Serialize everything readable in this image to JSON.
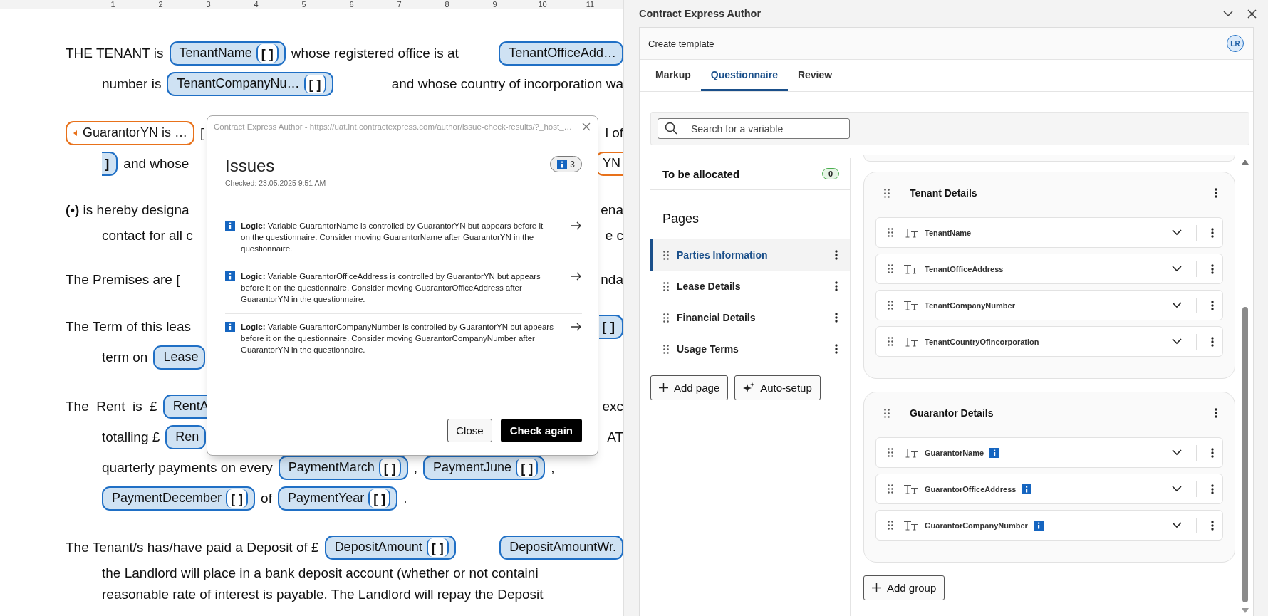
{
  "document": {
    "ruler": [
      "1",
      "2",
      "3",
      "4",
      "5",
      "6",
      "7",
      "8",
      "9",
      "10",
      "11"
    ],
    "paragraphs": [
      {
        "lines": [
          {
            "left": [
              {
                "kind": "text",
                "text": "THE TENANT is"
              },
              {
                "kind": "field",
                "name": "TenantName",
                "placeholder": "[ ]"
              },
              {
                "kind": "text",
                "text": "whose registered office is at"
              }
            ],
            "right": [
              {
                "kind": "field",
                "name": "TenantOfficeAdd…"
              }
            ]
          },
          {
            "left": [
              {
                "kind": "text",
                "text": "number is"
              },
              {
                "kind": "field",
                "name": "TenantCompanyNu…",
                "placeholder": "[ ]"
              }
            ],
            "right": [
              {
                "kind": "text",
                "text": "and whose country of incorporation wa"
              }
            ]
          }
        ]
      },
      {
        "lines": [
          {
            "left": [
              {
                "kind": "condition",
                "name": "GuarantorYN is …"
              },
              {
                "kind": "text",
                "text": "["
              }
            ],
            "right": [
              {
                "kind": "text",
                "text": "l of"
              }
            ]
          },
          {
            "left": [
              {
                "kind": "tail",
                "text": "]"
              },
              {
                "kind": "text",
                "text": "and whose"
              }
            ],
            "right": [
              {
                "kind": "condition_tail",
                "text": "YN"
              }
            ]
          }
        ]
      },
      {
        "lines": [
          {
            "left": [
              {
                "kind": "text",
                "text": "**(•)** is hereby designa"
              }
            ],
            "right": [
              {
                "kind": "text",
                "text": "ena"
              }
            ]
          },
          {
            "left": [
              {
                "kind": "text",
                "text": "contact for all c"
              }
            ],
            "right": [
              {
                "kind": "text",
                "text": "e c"
              }
            ]
          }
        ]
      },
      {
        "lines": [
          {
            "left": [
              {
                "kind": "text",
                "text": "The Premises are ["
              }
            ],
            "right": [
              {
                "kind": "text",
                "text": "nda"
              }
            ]
          }
        ]
      },
      {
        "lines": [
          {
            "left": [
              {
                "kind": "text",
                "text": "The Term of this leas"
              }
            ],
            "right": [
              {
                "kind": "tail",
                "text": "[ ]"
              }
            ]
          },
          {
            "left": [
              {
                "kind": "text",
                "text": "term on"
              },
              {
                "kind": "field",
                "name": "Lease"
              }
            ]
          }
        ]
      },
      {
        "lines": [
          {
            "left": [
              {
                "kind": "text",
                "text": "The  Rent  is  £"
              },
              {
                "kind": "field",
                "name": "RentA"
              }
            ],
            "right": [
              {
                "kind": "text",
                "text": "exc"
              }
            ]
          },
          {
            "left": [
              {
                "kind": "text",
                "text": "totalling £"
              },
              {
                "kind": "field",
                "name": "Ren"
              }
            ],
            "right": [
              {
                "kind": "text",
                "text": "AT"
              }
            ]
          },
          {
            "left": [
              {
                "kind": "text",
                "text": "quarterly payments on every"
              },
              {
                "kind": "field",
                "name": "PaymentMarch",
                "placeholder": "[ ]"
              },
              {
                "kind": "text",
                "text": ","
              },
              {
                "kind": "field",
                "name": "PaymentJune",
                "placeholder": "[ ]"
              },
              {
                "kind": "text",
                "text": ","
              }
            ]
          },
          {
            "left": [
              {
                "kind": "field",
                "name": "PaymentDecember",
                "placeholder": "[ ]"
              },
              {
                "kind": "text",
                "text": "of"
              },
              {
                "kind": "field",
                "name": "PaymentYear",
                "placeholder": "[ ]"
              },
              {
                "kind": "text",
                "text": "."
              }
            ]
          }
        ]
      },
      {
        "lines": [
          {
            "left": [
              {
                "kind": "text",
                "text": "The Tenant/s has/have paid a Deposit of £"
              },
              {
                "kind": "field",
                "name": "DepositAmount",
                "placeholder": "[ ]"
              }
            ],
            "right": [
              {
                "kind": "field",
                "name": "DepositAmountWr."
              }
            ]
          },
          {
            "left": [
              {
                "kind": "text",
                "text": "the Landlord will place in a bank deposit account (whether or not containi"
              }
            ]
          },
          {
            "left": [
              {
                "kind": "text",
                "text": "reasonable rate of interest is payable. The Landlord will repay the Deposit"
              }
            ]
          }
        ]
      }
    ]
  },
  "dialog": {
    "title": "Contract Express Author - https://uat.int.contractexpress.com/author/issue-check-results/?_host_…",
    "heading": "Issues",
    "checked": "Checked: 23.05.2025 9:51 AM",
    "count": "3",
    "issues": [
      "**Logic:** Variable GuarantorName is controlled by GuarantorYN but appears before it on the questionnaire. Consider moving GuarantorName after GuarantorYN in the questionnaire.",
      "**Logic:** Variable GuarantorOfficeAddress is controlled by GuarantorYN but appears before it on the questionnaire. Consider moving GuarantorOfficeAddress after GuarantorYN in the questionnaire.",
      "**Logic:** Variable GuarantorCompanyNumber is controlled by GuarantorYN but appears before it on the questionnaire. Consider moving GuarantorCompanyNumber after GuarantorYN in the questionnaire."
    ],
    "buttons": [
      {
        "label": "Close",
        "kind": "secondary"
      },
      {
        "label": "Check again",
        "kind": "primary"
      }
    ]
  },
  "panel": {
    "title": "Contract Express Author",
    "header": "Create template",
    "avatar": "LR",
    "tabs": [
      {
        "label": "Markup",
        "selected": false
      },
      {
        "label": "Questionnaire",
        "selected": true
      },
      {
        "label": "Review",
        "selected": false
      }
    ],
    "search": {
      "placeholder": "Search for a variable"
    },
    "unallocated": {
      "label": "To be allocated",
      "count": "0"
    },
    "pages_heading": "Pages",
    "pages": [
      {
        "label": "Parties Information",
        "selected": true
      },
      {
        "label": "Lease Details",
        "selected": false
      },
      {
        "label": "Financial Details",
        "selected": false
      },
      {
        "label": "Usage Terms",
        "selected": false
      }
    ],
    "page_buttons": [
      {
        "label": "Add page",
        "kind": "add"
      },
      {
        "label": "Auto-setup",
        "kind": "auto"
      }
    ],
    "groups": [
      {
        "title": "Tenant Details",
        "variables": [
          {
            "name": "TenantName",
            "issue": false
          },
          {
            "name": "TenantOfficeAddress",
            "issue": false
          },
          {
            "name": "TenantCompanyNumber",
            "issue": false
          },
          {
            "name": "TenantCountryOfIncorporation",
            "issue": false
          }
        ]
      },
      {
        "title": "Guarantor Details",
        "variables": [
          {
            "name": "GuarantorName",
            "issue": true
          },
          {
            "name": "GuarantorOfficeAddress",
            "issue": true
          },
          {
            "name": "GuarantorCompanyNumber",
            "issue": true
          }
        ]
      }
    ],
    "add_group": "Add group"
  }
}
